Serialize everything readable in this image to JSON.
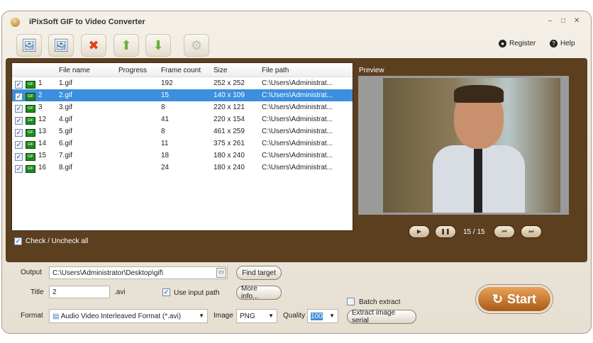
{
  "app": {
    "title": "iPixSoft GIF to Video Converter"
  },
  "window_controls": {
    "minimize": "–",
    "maximize": "□",
    "close": "✕"
  },
  "toolbar": {
    "buttons": [
      {
        "name": "add-file",
        "icon": "🖼"
      },
      {
        "name": "remove-file",
        "icon": "🖼"
      },
      {
        "name": "clear-list",
        "icon": "✖"
      },
      {
        "name": "move-up",
        "icon": "⬆"
      },
      {
        "name": "move-down",
        "icon": "⬇"
      },
      {
        "name": "settings",
        "icon": "⚙"
      }
    ],
    "register": "Register",
    "help": "Help"
  },
  "list": {
    "columns": [
      "File name",
      "Progress",
      "Frame count",
      "Size",
      "File path"
    ],
    "rows": [
      {
        "num": "1",
        "name": "1.gif",
        "progress": "",
        "frames": "192",
        "size": "252 x 252",
        "path": "C:\\Users\\Administrat...",
        "selected": false
      },
      {
        "num": "2",
        "name": "2.gif",
        "progress": "",
        "frames": "15",
        "size": "140 x 109",
        "path": "C:\\Users\\Administrat...",
        "selected": true
      },
      {
        "num": "3",
        "name": "3.gif",
        "progress": "",
        "frames": "8",
        "size": "220 x 121",
        "path": "C:\\Users\\Administrat...",
        "selected": false
      },
      {
        "num": "12",
        "name": "4.gif",
        "progress": "",
        "frames": "41",
        "size": "220 x 154",
        "path": "C:\\Users\\Administrat...",
        "selected": false
      },
      {
        "num": "13",
        "name": "5.gif",
        "progress": "",
        "frames": "8",
        "size": "461 x 259",
        "path": "C:\\Users\\Administrat...",
        "selected": false
      },
      {
        "num": "14",
        "name": "6.gif",
        "progress": "",
        "frames": "11",
        "size": "375 x 261",
        "path": "C:\\Users\\Administrat...",
        "selected": false
      },
      {
        "num": "15",
        "name": "7.gif",
        "progress": "",
        "frames": "18",
        "size": "180 x 240",
        "path": "C:\\Users\\Administrat...",
        "selected": false
      },
      {
        "num": "16",
        "name": "8.gif",
        "progress": "",
        "frames": "24",
        "size": "180 x 240",
        "path": "C:\\Users\\Administrat...",
        "selected": false
      }
    ],
    "check_all": "Check / Uncheck all",
    "gif_badge": "GIF"
  },
  "preview": {
    "label": "Preview",
    "frame_counter": "15 / 15",
    "play": "▶",
    "pause": "❚❚",
    "first": "⏮",
    "last": "⏭"
  },
  "output": {
    "output_label": "Output",
    "output_path": "C:\\Users\\Administrator\\Desktop\\gif\\",
    "find_target": "Find target",
    "title_label": "Title",
    "title_value": "2",
    "ext": ".avi",
    "use_input_path": "Use input path",
    "more_info": "More info...",
    "batch_extract": "Batch extract",
    "format_label": "Format",
    "format_value": "Audio Video Interleaved Format (*.avi)",
    "image_label": "Image",
    "image_value": "PNG",
    "quality_label": "Quality",
    "quality_value": "100",
    "extract_serial": "Extract image serial",
    "start": "Start"
  }
}
